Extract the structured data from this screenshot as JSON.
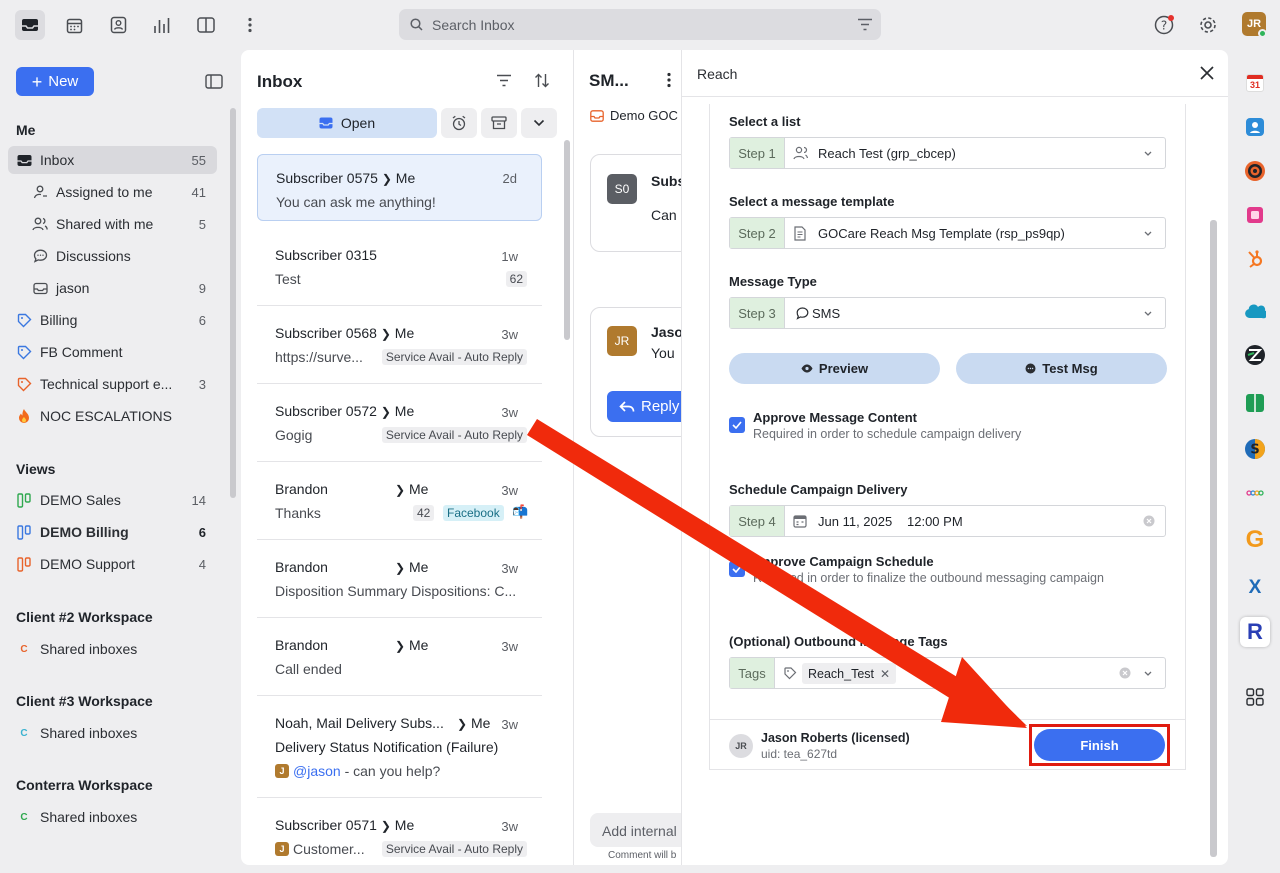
{
  "topbar": {
    "search_placeholder": "Search Inbox",
    "avatar": "JR"
  },
  "sidebar": {
    "new_label": "New",
    "me_heading": "Me",
    "items": [
      {
        "label": "Inbox",
        "count": "55"
      },
      {
        "label": "Assigned to me",
        "count": "41"
      },
      {
        "label": "Shared with me",
        "count": "5"
      },
      {
        "label": "Discussions",
        "count": ""
      },
      {
        "label": "jason",
        "count": "9"
      },
      {
        "label": "Billing",
        "count": "6"
      },
      {
        "label": "FB Comment",
        "count": ""
      },
      {
        "label": "Technical support e...",
        "count": "3"
      },
      {
        "label": "NOC ESCALATIONS",
        "count": ""
      }
    ],
    "views_heading": "Views",
    "views": [
      {
        "label": "DEMO Sales",
        "count": "14"
      },
      {
        "label": "DEMO Billing",
        "count": "6"
      },
      {
        "label": "DEMO Support",
        "count": "4"
      }
    ],
    "workspaces": [
      {
        "heading": "Client #2 Workspace",
        "item": "Shared inboxes",
        "letter": "C",
        "color": "#e8632b"
      },
      {
        "heading": "Client #3 Workspace",
        "item": "Shared inboxes",
        "letter": "C",
        "color": "#3bb2d0"
      },
      {
        "heading": "Conterra Workspace",
        "item": "Shared inboxes",
        "letter": "C",
        "color": "#2fa84f"
      }
    ]
  },
  "inbox": {
    "title": "Inbox",
    "open_label": "Open",
    "conversations": [
      {
        "from": "Subscriber 0575",
        "to": "Me",
        "time": "2d",
        "preview": "You can ask me anything!"
      },
      {
        "from": "Subscriber 0315",
        "to": "",
        "time": "1w",
        "preview": "Test",
        "count": "62"
      },
      {
        "from": "Subscriber 0568",
        "to": "Me",
        "time": "3w",
        "preview": "https://surve...",
        "tag": "Service Avail - Auto Reply"
      },
      {
        "from": "Subscriber 0572",
        "to": "Me",
        "time": "3w",
        "preview": "Gogig",
        "tag": "Service Avail - Auto Reply"
      },
      {
        "from": "Brandon",
        "to": "Me",
        "time": "3w",
        "preview": "Thanks",
        "count": "42",
        "tag": "Facebook"
      },
      {
        "from": "Brandon",
        "to": "Me",
        "time": "3w",
        "preview": "Disposition Summary Dispositions: C..."
      },
      {
        "from": "Brandon",
        "to": "Me",
        "time": "3w",
        "preview": "Call ended"
      },
      {
        "from": "Noah, Mail Delivery Subs...",
        "to": "Me",
        "time": "3w",
        "preview": "Delivery Status Notification (Failure)",
        "mention": "@jason",
        "mention_text": " - can you help?",
        "badge": "J"
      },
      {
        "from": "Subscriber 0571",
        "to": "Me",
        "time": "3w",
        "preview": "Customer...",
        "tag": "Service Avail - Auto Reply",
        "badge": "J"
      }
    ]
  },
  "thread": {
    "title": "SM...",
    "inbox_tag": "Demo GOC",
    "msg1_avatar": "S0",
    "msg1_from": "Subs",
    "msg1_text": "Can",
    "msg2_avatar": "JR",
    "msg2_from": "Jaso",
    "msg2_text": "You",
    "reply_label": "Reply",
    "compose_placeholder": "Add internal",
    "compose_hint": "Comment will b"
  },
  "reach": {
    "title": "Reach",
    "list_label": "Select a list",
    "step1": "Step 1",
    "list_value": "Reach Test (grp_cbcep)",
    "template_label": "Select a message template",
    "step2": "Step 2",
    "template_value": "GOCare Reach Msg Template (rsp_ps9qp)",
    "type_label": "Message Type",
    "step3": "Step 3",
    "type_value": "SMS",
    "preview_label": "Preview",
    "test_label": "Test Msg",
    "approve_content_title": "Approve Message Content",
    "approve_content_sub": "Required in order to schedule campaign delivery",
    "schedule_label": "Schedule Campaign Delivery",
    "step4": "Step 4",
    "schedule_date": "Jun 11, 2025",
    "schedule_time": "12:00 PM",
    "approve_schedule_title": "Approve Campaign Schedule",
    "approve_schedule_sub": "Required in order to finalize the outbound messaging campaign",
    "tags_label": "(Optional) Outbound Message Tags",
    "tags_step": "Tags",
    "tag_value": "Reach_Test",
    "user_initials": "JR",
    "user_name": "Jason Roberts (licensed)",
    "user_uid": "uid: tea_627td",
    "finish_label": "Finish"
  },
  "rail": {
    "calendar_day": "31",
    "g_letter": "G",
    "x_letter": "X",
    "r_letter": "R"
  },
  "colors": {
    "accent": "#3b6ff0",
    "arrow": "#f02a0c",
    "step_bg": "#dff0df"
  }
}
